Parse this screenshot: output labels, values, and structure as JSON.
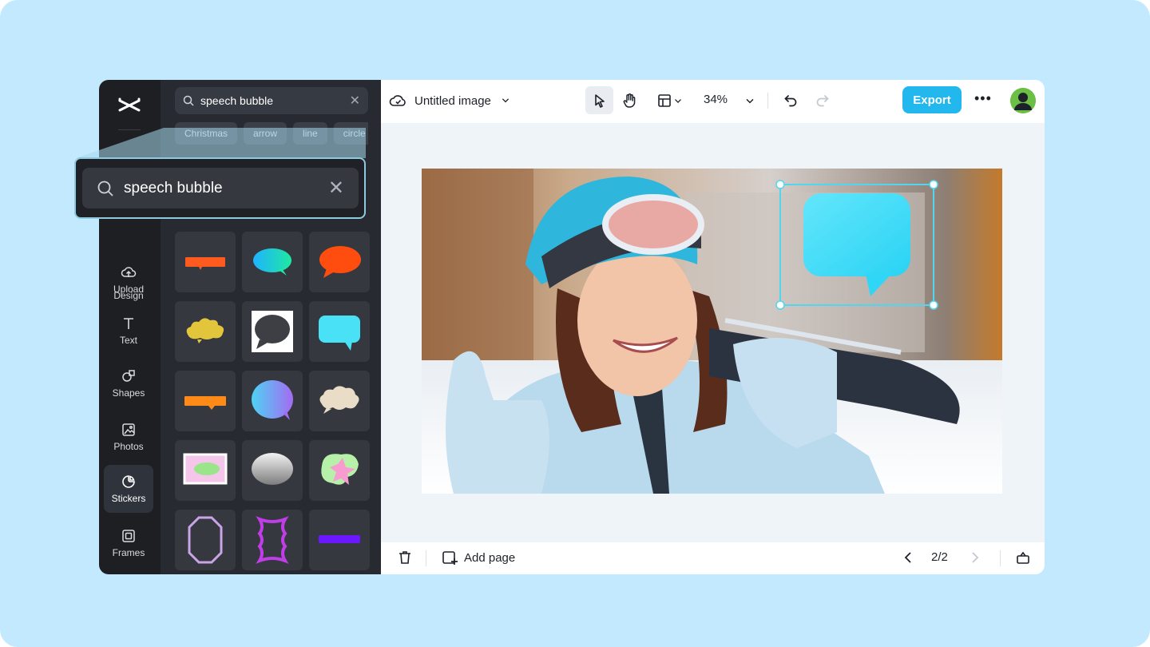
{
  "search": {
    "value": "speech bubble",
    "clear_icon": "close-icon"
  },
  "chips": [
    "Christmas",
    "arrow",
    "line",
    "circle"
  ],
  "rail": [
    {
      "label": "Design",
      "icon": "design-icon"
    },
    {
      "label": "Upload",
      "icon": "upload-icon"
    },
    {
      "label": "Text",
      "icon": "text-icon"
    },
    {
      "label": "Shapes",
      "icon": "shapes-icon"
    },
    {
      "label": "Photos",
      "icon": "photos-icon"
    },
    {
      "label": "Stickers",
      "icon": "stickers-icon",
      "active": true
    },
    {
      "label": "Frames",
      "icon": "frames-icon"
    }
  ],
  "topbar": {
    "title": "Untitled image",
    "zoom": "34%",
    "export_label": "Export"
  },
  "bottombar": {
    "add_page_label": "Add page",
    "page_indicator": "2/2"
  },
  "colors": {
    "accent": "#22b8ee",
    "selection": "#4dd5ee",
    "rail_bg": "#1d1f23",
    "panel_bg": "#272a30"
  }
}
